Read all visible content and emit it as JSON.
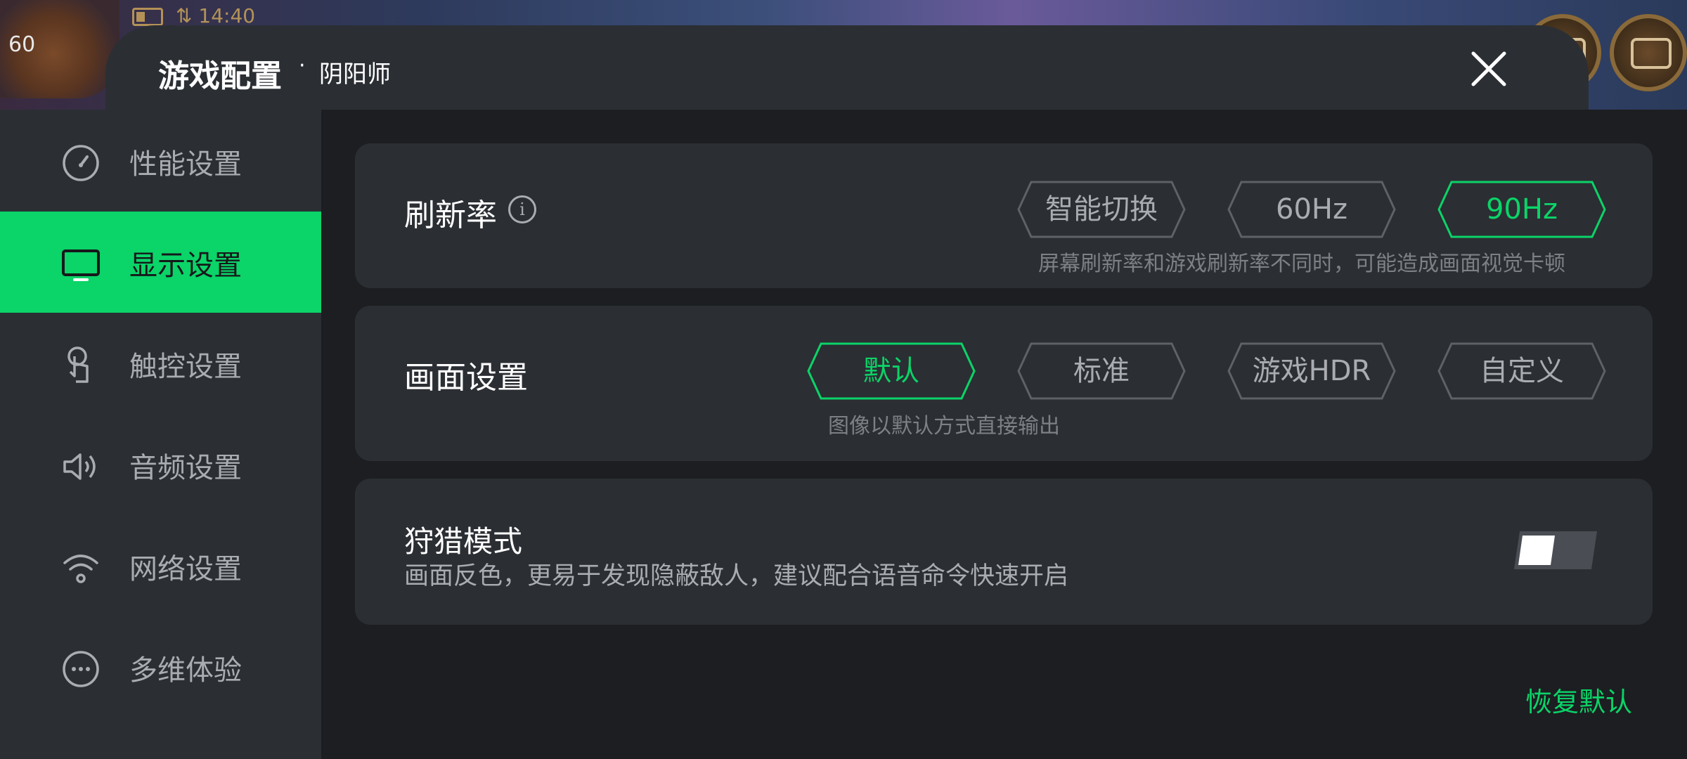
{
  "game_overlay": {
    "fps": "60",
    "clock": "14:40"
  },
  "header": {
    "title": "游戏配置",
    "separator": "·",
    "game_name": "阴阳师",
    "close_icon": "close-icon"
  },
  "sidebar": {
    "items": [
      {
        "label": "性能设置",
        "icon": "gauge-icon"
      },
      {
        "label": "显示设置",
        "icon": "monitor-icon",
        "active": true
      },
      {
        "label": "触控设置",
        "icon": "touch-icon"
      },
      {
        "label": "音频设置",
        "icon": "speaker-icon"
      },
      {
        "label": "网络设置",
        "icon": "wifi-icon"
      },
      {
        "label": "多维体验",
        "icon": "more-icon"
      }
    ]
  },
  "refresh_rate": {
    "title": "刷新率",
    "info_icon": "i",
    "options": [
      "智能切换",
      "60Hz",
      "90Hz"
    ],
    "selected": "90Hz",
    "hint": "屏幕刷新率和游戏刷新率不同时，可能造成画面视觉卡顿"
  },
  "picture": {
    "title": "画面设置",
    "options": [
      "默认",
      "标准",
      "游戏HDR",
      "自定义"
    ],
    "selected": "默认",
    "hint": "图像以默认方式直接输出"
  },
  "hunting": {
    "title": "狩猎模式",
    "description": "画面反色，更易于发现隐蔽敌人，建议配合语音命令快速开启",
    "enabled": false
  },
  "footer": {
    "restore_label": "恢复默认"
  },
  "colors": {
    "accent": "#0bd468",
    "panel": "#2b2e33",
    "background": "#1c1e21"
  }
}
